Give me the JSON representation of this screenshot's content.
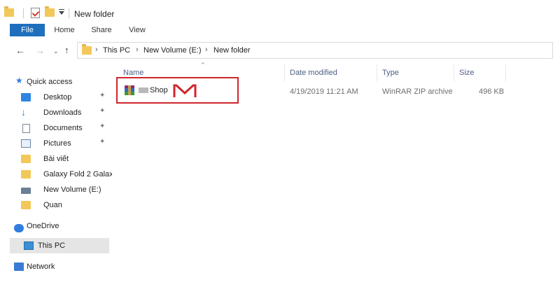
{
  "titlebar": {
    "title": "New folder"
  },
  "ribbon": {
    "tabs": [
      "File",
      "Home",
      "Share",
      "View"
    ]
  },
  "address": {
    "crumbs": [
      "This PC",
      "New Volume (E:)",
      "New folder"
    ]
  },
  "nav": {
    "items": [
      {
        "label": "Quick access",
        "icon": "star-icon"
      },
      {
        "label": "Desktop",
        "icon": "desktop-icon",
        "pinned": true
      },
      {
        "label": "Downloads",
        "icon": "download-icon",
        "pinned": true
      },
      {
        "label": "Documents",
        "icon": "documents-icon",
        "pinned": true
      },
      {
        "label": "Pictures",
        "icon": "pictures-icon",
        "pinned": true
      },
      {
        "label": "Bài viết",
        "icon": "folder-icon"
      },
      {
        "label": "Galaxy Fold 2 Galax",
        "icon": "folder-icon"
      },
      {
        "label": "New Volume (E:)",
        "icon": "drive-icon"
      },
      {
        "label": "Quan",
        "icon": "folder-icon"
      },
      {
        "label": "OneDrive",
        "icon": "cloud-icon"
      },
      {
        "label": "This PC",
        "icon": "pc-icon",
        "selected": true
      },
      {
        "label": "Network",
        "icon": "network-icon"
      }
    ]
  },
  "columns": {
    "name": "Name",
    "date": "Date modified",
    "type": "Type",
    "size": "Size"
  },
  "files": [
    {
      "name": "Shop",
      "date": "4/19/2019 11:21 AM",
      "type": "WinRAR ZIP archive",
      "size": "496 KB"
    }
  ],
  "colors": {
    "accent": "#1f6fbd",
    "highlight": "#d0262c",
    "selected": "#e5e5e5"
  }
}
